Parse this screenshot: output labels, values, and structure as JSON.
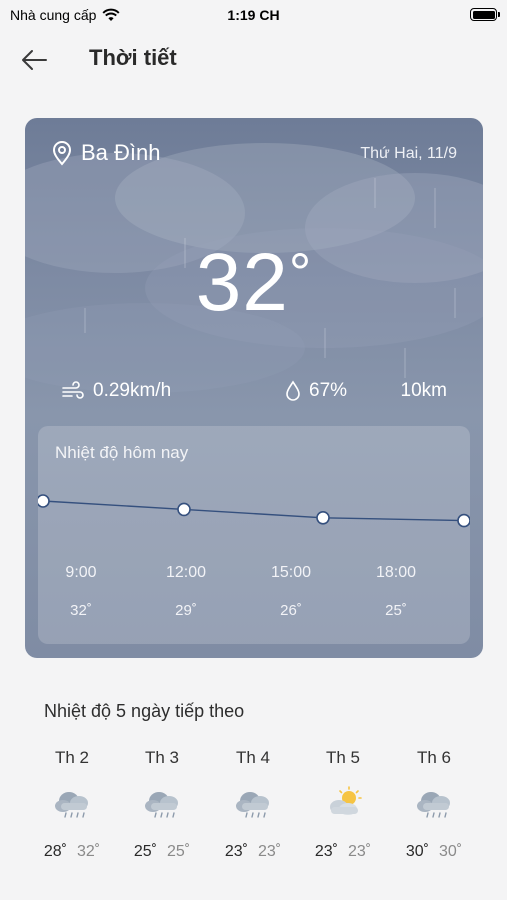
{
  "status_bar": {
    "carrier": "Nhà cung cấp",
    "time": "1:19 CH"
  },
  "header": {
    "title": "Thời tiết"
  },
  "current": {
    "location": "Ba Đình",
    "date": "Thứ Hai, 11/9",
    "temperature": "32",
    "wind": "0.29km/h",
    "humidity": "67%",
    "visibility": "10km"
  },
  "hourly": {
    "title": "Nhiệt độ hôm nay",
    "times": [
      "9:00",
      "12:00",
      "15:00",
      "18:00"
    ],
    "temps": [
      "32˚",
      "29˚",
      "26˚",
      "25˚"
    ],
    "line_color": "#35507e"
  },
  "forecast": {
    "title": "Nhiệt độ 5 ngày tiếp theo",
    "days": [
      {
        "label": "Th 2",
        "icon": "rain-cloud-icon",
        "high": "28˚",
        "low": "32˚"
      },
      {
        "label": "Th 3",
        "icon": "rain-cloud-icon",
        "high": "25˚",
        "low": "25˚"
      },
      {
        "label": "Th 4",
        "icon": "rain-cloud-icon",
        "high": "23˚",
        "low": "23˚"
      },
      {
        "label": "Th 5",
        "icon": "sun-cloud-icon",
        "high": "23˚",
        "low": "23˚"
      },
      {
        "label": "Th 6",
        "icon": "rain-cloud-icon",
        "high": "30˚",
        "low": "30˚"
      }
    ]
  }
}
